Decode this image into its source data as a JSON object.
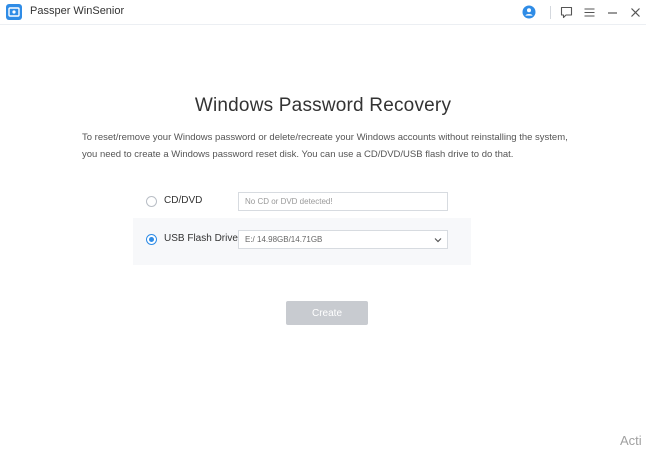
{
  "window": {
    "title": "Passper WinSenior"
  },
  "main": {
    "title": "Windows Password Recovery",
    "description": "To reset/remove your Windows password or delete/recreate your Windows accounts without reinstalling the system, you need to create a Windows password reset disk. You can use a CD/DVD/USB flash drive to do that.",
    "options": [
      {
        "label": "CD/DVD",
        "selected": false,
        "field_value": "No CD or DVD detected!"
      },
      {
        "label": "USB Flash Drive",
        "selected": true,
        "field_value": "E:/ 14.98GB/14.71GB"
      }
    ],
    "create_label": "Create"
  },
  "watermark": "Acti",
  "colors": {
    "accent": "#2f8ce6",
    "button_disabled": "#c8cbd0"
  }
}
